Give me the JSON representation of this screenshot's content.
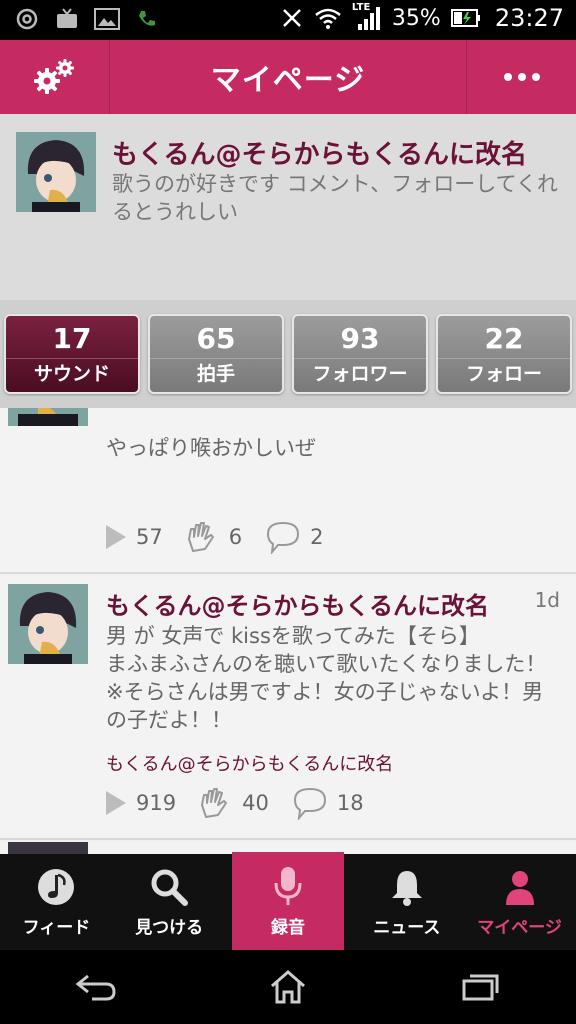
{
  "status_bar": {
    "left_icons": [
      "at-icon",
      "tv-icon",
      "image-icon",
      "phone-icon"
    ],
    "battery_percent": "35%",
    "network": "LTE",
    "time": "23:27"
  },
  "header": {
    "title": "マイページ",
    "settings_icon": "gears-icon",
    "more_icon": "more-dots-icon"
  },
  "profile": {
    "name": "もくるん@そらからもくるんに改名",
    "bio": "歌うのが好きです コメント、フォローしてくれるとうれしい"
  },
  "stats": [
    {
      "count": "17",
      "label": "サウンド",
      "active": true
    },
    {
      "count": "65",
      "label": "拍手",
      "active": false
    },
    {
      "count": "93",
      "label": "フォロワー",
      "active": false
    },
    {
      "count": "22",
      "label": "フォロー",
      "active": false
    }
  ],
  "posts": [
    {
      "text": "やっぱり喉おかしいぜ",
      "plays": "57",
      "claps": "6",
      "comments": "2"
    },
    {
      "author": "もくるん@そらからもくるんに改名",
      "time": "1d",
      "text": "男 が 女声で kissを歌ってみた【そら】 まふまふさんのを聴いて歌いたくなりました！※そらさんは男ですよ！女の子じゃないよ！男の子だよ！！",
      "text_lines": [
        "男 が 女声で kissを歌ってみた【そら】",
        "まふまふさんのを聴いて歌いたくなりました！",
        "※そらさんは男ですよ！女の子じゃないよ！男",
        "の子だよ！！"
      ],
      "sub_author": "もくるん@そらからもくるんに改名",
      "plays": "919",
      "claps": "40",
      "comments": "18"
    }
  ],
  "bottom_nav": [
    {
      "label": "フィード",
      "icon": "music-note-icon"
    },
    {
      "label": "見つける",
      "icon": "search-icon"
    },
    {
      "label": "録音",
      "icon": "microphone-icon"
    },
    {
      "label": "ニュース",
      "icon": "bell-icon"
    },
    {
      "label": "マイページ",
      "icon": "person-icon"
    }
  ],
  "system_nav": [
    "back-icon",
    "home-icon",
    "recent-apps-icon"
  ],
  "colors": {
    "brand": "#c62a63",
    "name_text": "#6a1238",
    "active_tab": "#5a1530"
  }
}
